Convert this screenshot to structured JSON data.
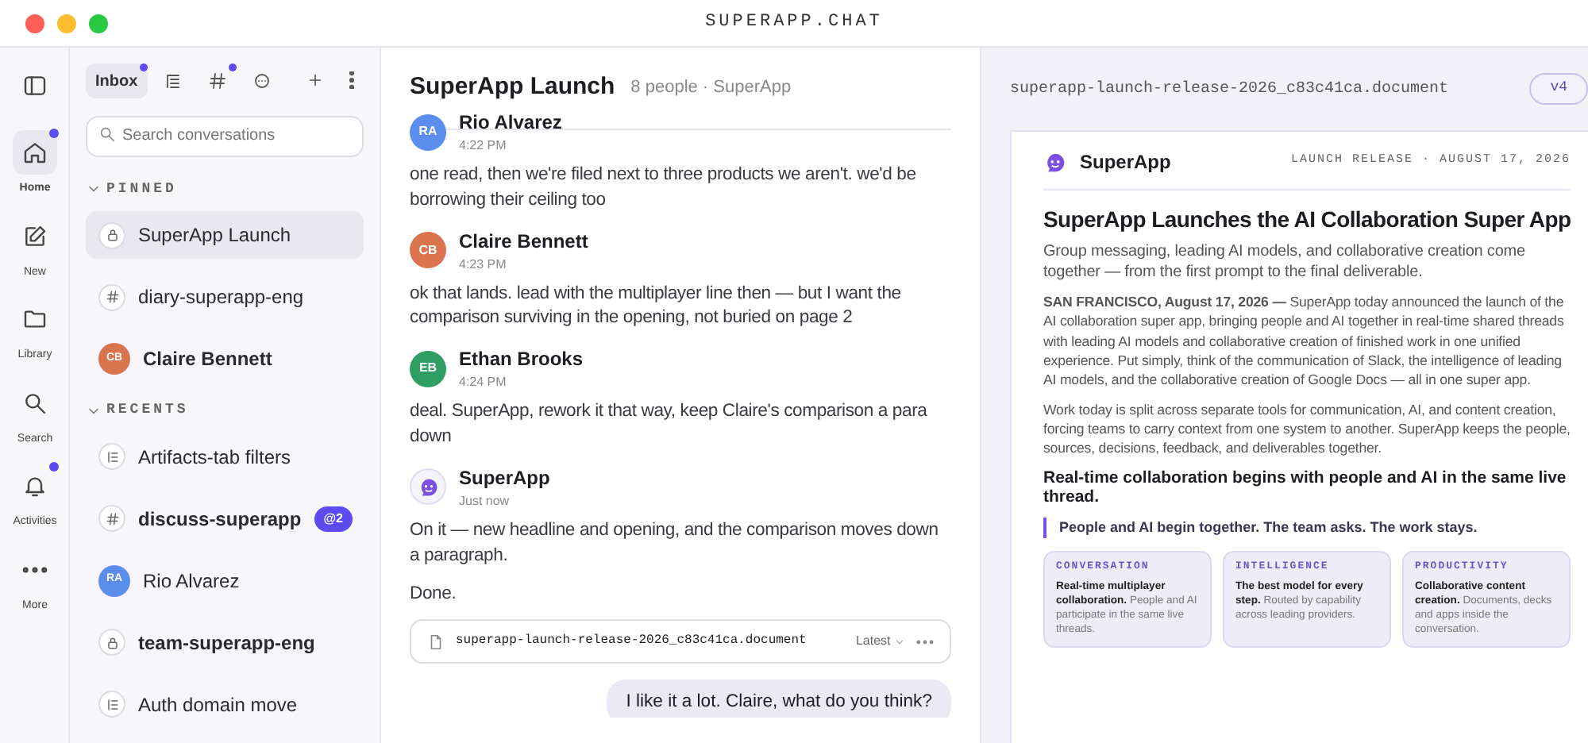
{
  "window": {
    "title": "SUPERAPP.CHAT",
    "controls": [
      {
        "color": "#ff5f57"
      },
      {
        "color": "#febc2e"
      },
      {
        "color": "#28c840"
      }
    ]
  },
  "rail": {
    "items": [
      {
        "kind": "sidebar",
        "selected": false,
        "unread": false
      },
      {
        "kind": "home",
        "label": "Home",
        "selected": true,
        "unread": true
      },
      {
        "kind": "new",
        "label": "New",
        "selected": false,
        "unread": false
      },
      {
        "kind": "library",
        "label": "Library",
        "selected": false,
        "unread": false
      },
      {
        "kind": "search",
        "label": "Search",
        "selected": false,
        "unread": false
      },
      {
        "kind": "activities",
        "label": "Activities",
        "selected": false,
        "unread": true
      },
      {
        "kind": "more",
        "label": "More",
        "selected": false,
        "unread": false
      }
    ]
  },
  "sidebar": {
    "tabs": [
      {
        "kind": "inbox",
        "label": "Inbox",
        "selected": true,
        "unread": true
      },
      {
        "kind": "threads",
        "selected": false,
        "unread": false
      },
      {
        "kind": "channels",
        "selected": false,
        "unread": true
      },
      {
        "kind": "chats",
        "selected": false,
        "unread": false
      }
    ],
    "search": {
      "placeholder": "Search conversations"
    },
    "sections": [
      {
        "title": "PINNED",
        "expanded": true,
        "items": [
          {
            "kind": "lock",
            "name": "SuperApp Launch",
            "bold": false,
            "selected": true
          },
          {
            "kind": "hash",
            "name": "diary-superapp-eng",
            "bold": false,
            "selected": false
          },
          {
            "kind": "avatar",
            "name": "Claire Bennett",
            "initials": "CB",
            "color": "#d9744f",
            "bold": true,
            "selected": false
          }
        ]
      },
      {
        "title": "RECENTS",
        "expanded": true,
        "items": [
          {
            "kind": "thread",
            "name": "Artifacts-tab filters",
            "bold": false,
            "selected": false
          },
          {
            "kind": "hash",
            "name": "discuss-superapp",
            "bold": true,
            "selected": false,
            "badge": "@2"
          },
          {
            "kind": "avatar",
            "name": "Rio Alvarez",
            "initials": "RA",
            "color": "#5b8def",
            "bold": false,
            "selected": false
          },
          {
            "kind": "lock",
            "name": "team-superapp-eng",
            "bold": true,
            "selected": false
          },
          {
            "kind": "thread",
            "name": "Auth domain move",
            "bold": false,
            "selected": false
          }
        ]
      }
    ]
  },
  "chat": {
    "title": "SuperApp Launch",
    "meta": "8 people · SuperApp",
    "messages": [
      {
        "kind": "person",
        "author": "Rio Alvarez",
        "initials": "RA",
        "color": "#5b8def",
        "time": "4:22 PM",
        "paragraphs": [
          "one read, then we're filed next to three products we aren't. we'd be borrowing their ceiling too"
        ]
      },
      {
        "kind": "person",
        "author": "Claire Bennett",
        "initials": "CB",
        "color": "#d9744f",
        "time": "4:23 PM",
        "paragraphs": [
          "ok that lands. lead with the multiplayer line then — but I want the comparison surviving in the opening, not buried on page 2"
        ]
      },
      {
        "kind": "person",
        "author": "Ethan Brooks",
        "initials": "EB",
        "color": "#2f9e62",
        "time": "4:24 PM",
        "paragraphs": [
          "deal. SuperApp, rework it that way, keep Claire's comparison a para down"
        ]
      },
      {
        "kind": "bot",
        "author": "SuperApp",
        "time": "Just now",
        "paragraphs": [
          "On it — new headline and opening, and the comparison moves down a paragraph.",
          "Done."
        ],
        "attachment": {
          "filename": "superapp-launch-release-2026_c83c41ca.document",
          "version": "Latest"
        }
      }
    ],
    "own_message": "I like it a lot. Claire, what do you think?"
  },
  "document": {
    "filename": "superapp-launch-release-2026_c83c41ca.document",
    "version": "v4",
    "brand": "SuperApp",
    "label": "LAUNCH RELEASE · AUGUST 17, 2026",
    "headline": "SuperApp Launches the AI Collaboration Super App",
    "subhead": "Group messaging, leading AI models, and collaborative creation come together — from the first prompt to the final deliverable.",
    "paragraphs": [
      "**SAN FRANCISCO, August 17, 2026 —** SuperApp today announced the launch of the AI collaboration super app, bringing people and AI together in real-time shared threads with leading AI models and collaborative creation of finished work in one unified experience. Put simply, think of the communication of Slack, the intelligence of leading AI models, and the collaborative creation of Google Docs — all in one super app.",
      "Work today is split across separate tools for communication, AI, and content creation, forcing teams to carry context from one system to another. SuperApp keeps the people, sources, decisions, feedback, and deliverables together."
    ],
    "heading": "Real-time collaboration begins with people and AI in the same live thread.",
    "quote": "People and AI begin together. The team asks. The work stays.",
    "cards": [
      {
        "tag": "CONVERSATION",
        "text": "**Real-time multiplayer collaboration.** People and AI participate in the same live threads."
      },
      {
        "tag": "INTELLIGENCE",
        "text": "**The best model for every step.** Routed by capability across leading providers."
      },
      {
        "tag": "PRODUCTIVITY",
        "text": "**Collaborative content creation.** Documents, decks and apps inside the conversation."
      }
    ]
  }
}
